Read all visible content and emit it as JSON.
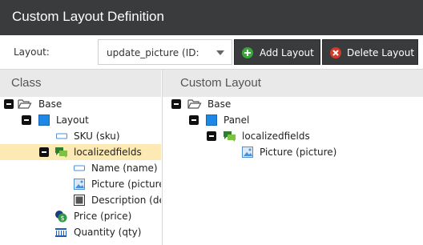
{
  "window": {
    "title": "Custom Layout Definition"
  },
  "toolbar": {
    "layout_label": "Layout:",
    "layout_select_value": "update_picture (ID:",
    "add_layout_label": "Add Layout",
    "delete_layout_label": "Delete Layout"
  },
  "class_panel": {
    "header": "Class",
    "nodes": [
      {
        "label": "Base",
        "icon": "folder-open-icon"
      },
      {
        "label": "Layout",
        "icon": "layout-icon"
      },
      {
        "label": "SKU (sku)",
        "icon": "input-field-icon"
      },
      {
        "label": "localizedfields",
        "icon": "chat-bubbles-icon",
        "selected": true
      },
      {
        "label": "Name (name)",
        "icon": "input-field-icon"
      },
      {
        "label": "Picture (picture)",
        "icon": "image-icon"
      },
      {
        "label": "Description (description)",
        "icon": "textarea-icon"
      },
      {
        "label": "Price (price)",
        "icon": "coin-dollar-icon"
      },
      {
        "label": "Quantity (qty)",
        "icon": "numeric-icon"
      }
    ]
  },
  "layout_panel": {
    "header": "Custom Layout",
    "nodes": [
      {
        "label": "Base",
        "icon": "folder-open-icon"
      },
      {
        "label": "Panel",
        "icon": "layout-icon"
      },
      {
        "label": "localizedfields",
        "icon": "chat-bubbles-icon"
      },
      {
        "label": "Picture (picture)",
        "icon": "image-icon"
      }
    ]
  },
  "colors": {
    "titlebar": "#3a3b3c",
    "button_bg": "#3a3b3c",
    "add_icon": "#3aa73a",
    "delete_icon": "#d23a2a",
    "selected_row": "#fde9b3",
    "panel_header": "#e9e9e9"
  }
}
